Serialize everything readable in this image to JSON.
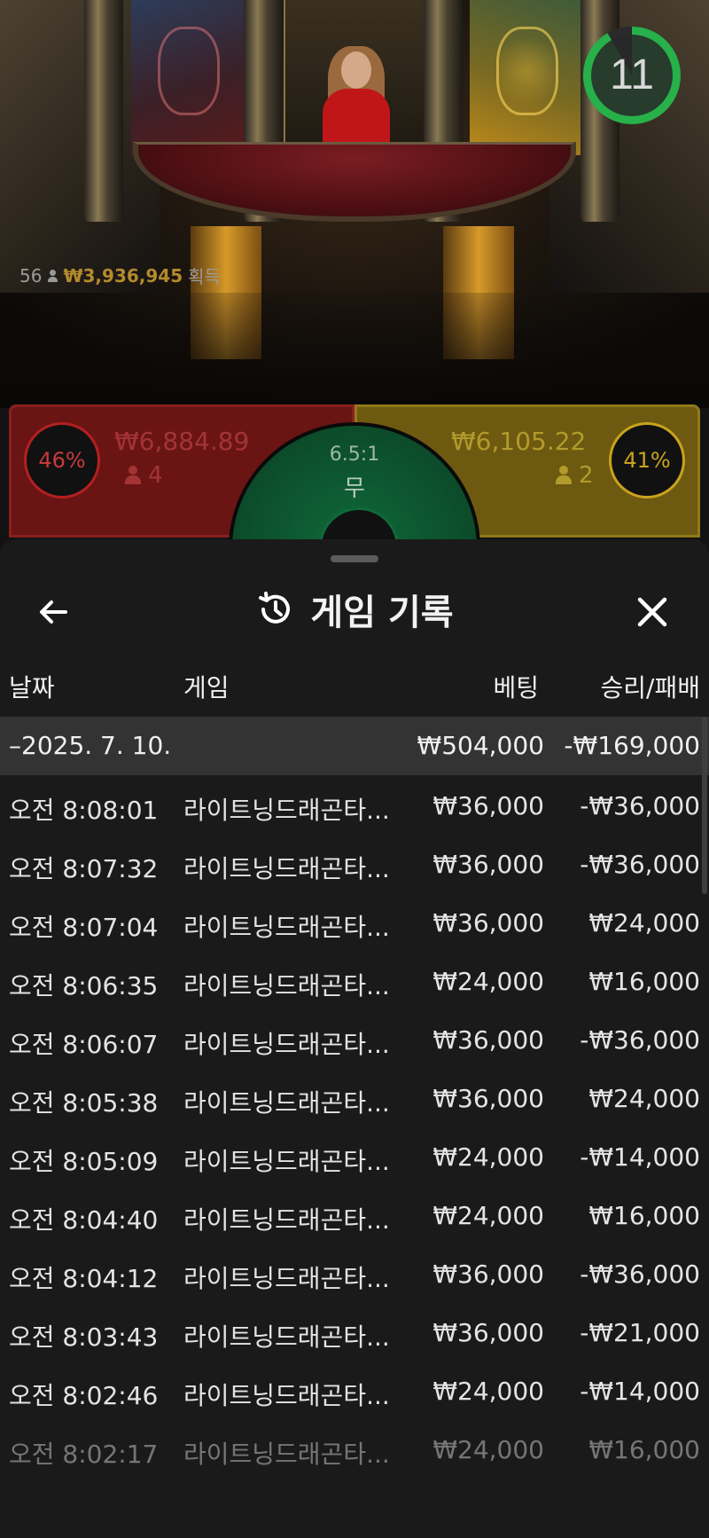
{
  "live": {
    "timer": "11",
    "winners_count": "56",
    "winners_amount": "₩3,936,945",
    "winners_suffix": "획득",
    "dragon": {
      "percent": "46%",
      "amount": "₩6,884.89",
      "players": "4"
    },
    "tiger": {
      "percent": "41%",
      "amount": "₩6,105.22",
      "players": "2"
    },
    "tie": {
      "odds": "6.5:1",
      "label": "무"
    }
  },
  "sheet": {
    "title": "게임 기록",
    "columns": {
      "date": "날짜",
      "game": "게임",
      "bet": "베팅",
      "win_loss": "승리/패배"
    },
    "group": {
      "date": "–2025. 7. 10.",
      "bet": "₩504,000",
      "win_loss": "-₩169,000"
    },
    "rows": [
      {
        "time": "오전 8:08:01",
        "game": "라이트닝드래곤타...",
        "bet": "₩36,000",
        "win_loss": "-₩36,000"
      },
      {
        "time": "오전 8:07:32",
        "game": "라이트닝드래곤타...",
        "bet": "₩36,000",
        "win_loss": "-₩36,000"
      },
      {
        "time": "오전 8:07:04",
        "game": "라이트닝드래곤타...",
        "bet": "₩36,000",
        "win_loss": "₩24,000"
      },
      {
        "time": "오전 8:06:35",
        "game": "라이트닝드래곤타...",
        "bet": "₩24,000",
        "win_loss": "₩16,000"
      },
      {
        "time": "오전 8:06:07",
        "game": "라이트닝드래곤타...",
        "bet": "₩36,000",
        "win_loss": "-₩36,000"
      },
      {
        "time": "오전 8:05:38",
        "game": "라이트닝드래곤타...",
        "bet": "₩36,000",
        "win_loss": "₩24,000"
      },
      {
        "time": "오전 8:05:09",
        "game": "라이트닝드래곤타...",
        "bet": "₩24,000",
        "win_loss": "-₩14,000"
      },
      {
        "time": "오전 8:04:40",
        "game": "라이트닝드래곤타...",
        "bet": "₩24,000",
        "win_loss": "₩16,000"
      },
      {
        "time": "오전 8:04:12",
        "game": "라이트닝드래곤타...",
        "bet": "₩36,000",
        "win_loss": "-₩36,000"
      },
      {
        "time": "오전 8:03:43",
        "game": "라이트닝드래곤타...",
        "bet": "₩36,000",
        "win_loss": "-₩21,000"
      },
      {
        "time": "오전 8:02:46",
        "game": "라이트닝드래곤타...",
        "bet": "₩24,000",
        "win_loss": "-₩14,000"
      },
      {
        "time": "오전 8:02:17",
        "game": "라이트닝드래곤타...",
        "bet": "₩24,000",
        "win_loss": "₩16,000"
      }
    ]
  },
  "icons": {
    "back": "arrow-left-icon",
    "history": "history-icon",
    "close": "close-icon",
    "person": "person-icon"
  },
  "colors": {
    "dragon": "#6a1414",
    "tiger": "#6d5a10",
    "tie": "#0f6a3a",
    "timer": "#27b14a",
    "sheet_bg": "#1a1a1a"
  }
}
